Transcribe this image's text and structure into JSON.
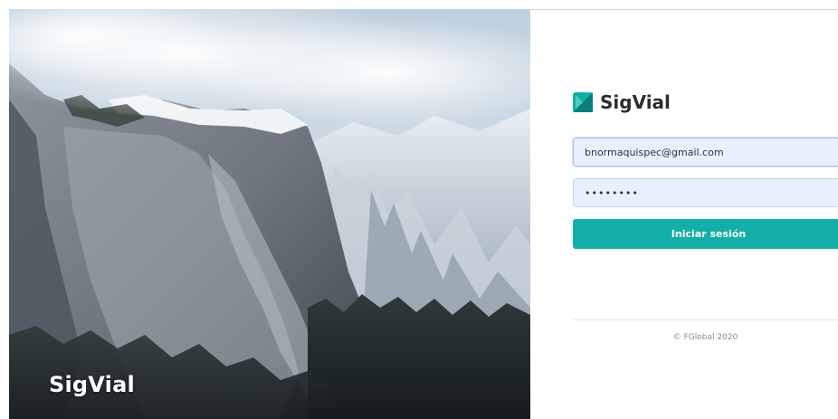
{
  "hero": {
    "title": "SigVial",
    "image_alt": "Mountain cliff with snow and clouds"
  },
  "brand": {
    "name": "SigVial",
    "logo_icon": "sigvial-logo-icon",
    "accent_color": "#12aea7"
  },
  "login": {
    "email_value": "bnormaquispec@gmail.com",
    "password_value": "••••••••",
    "submit_label": "Iniciar sesión"
  },
  "footer": {
    "copyright": "© FGlobal 2020"
  }
}
